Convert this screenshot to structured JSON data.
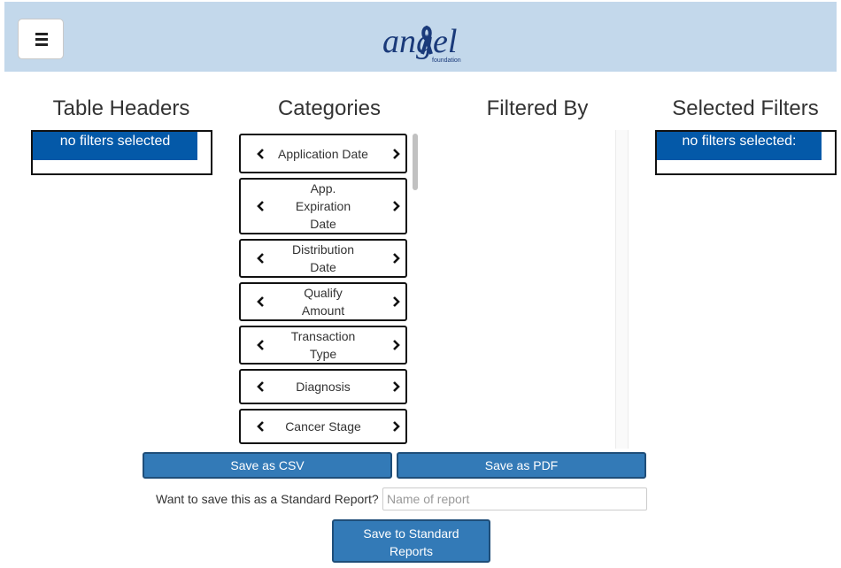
{
  "header": {
    "menu_icon": "hamburger-menu-icon",
    "logo_text": "angel",
    "logo_subtext": "foundation",
    "logo_color": "#1a3a7a",
    "background_color": "#c3d8eb"
  },
  "columns": {
    "table_headers": {
      "title": "Table Headers",
      "empty_text": "no filters selected"
    },
    "categories": {
      "title": "Categories"
    },
    "filtered_by": {
      "title": "Filtered By"
    },
    "selected_filters": {
      "title": "Selected Filters",
      "empty_text": "no filters selected:"
    }
  },
  "categories": {
    "items": [
      {
        "label": "Application Date"
      },
      {
        "label": "App. Expiration Date"
      },
      {
        "label": "Distribution Date"
      },
      {
        "label": "Qualify Amount"
      },
      {
        "label": "Transaction Type"
      },
      {
        "label": "Diagnosis"
      },
      {
        "label": "Cancer Stage"
      }
    ],
    "left_icon": "chevron-left-icon",
    "right_icon": "chevron-right-icon"
  },
  "actions": {
    "save_csv": "Save as CSV",
    "save_pdf": "Save as PDF",
    "standard_prompt": "Want to save this as a Standard Report?",
    "report_name_placeholder": "Name of report",
    "report_name_value": "",
    "save_standard": "Save to Standard Reports"
  },
  "colors": {
    "primary_button": "#337ab7",
    "selected_band": "#0459a8"
  }
}
